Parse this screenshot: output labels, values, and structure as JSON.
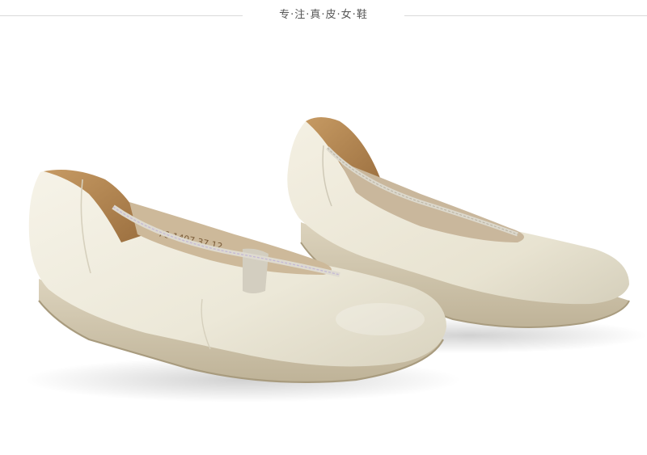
{
  "header": {
    "title": "专·注·真·皮·女·鞋"
  },
  "photo": {
    "insole_print": "76-1407 37 12"
  },
  "colors": {
    "leather": "#eeeadb",
    "sole": "#cfc4ab",
    "lining": "#b98955",
    "background": "#ffffff"
  }
}
